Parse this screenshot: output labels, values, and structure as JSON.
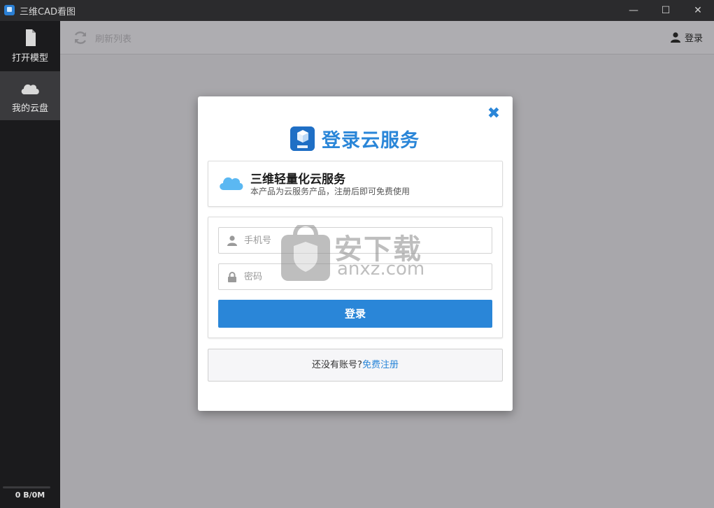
{
  "window": {
    "title": "三维CAD看图",
    "minimize_glyph": "—",
    "maximize_glyph": "☐",
    "close_glyph": "✕"
  },
  "sidebar": {
    "items": [
      {
        "label": "打开模型",
        "icon": "file-icon",
        "active": false
      },
      {
        "label": "我的云盘",
        "icon": "cloud-icon",
        "active": true
      }
    ],
    "storage": "0 B/0M"
  },
  "toolbar": {
    "refresh_label": "刷新列表",
    "login_label": "登录"
  },
  "dialog": {
    "close_glyph": "✖",
    "title": "登录云服务",
    "service": {
      "name": "三维轻量化云服务",
      "description": "本产品为云服务产品，注册后即可免费使用"
    },
    "phone_placeholder": "手机号",
    "password_placeholder": "密码",
    "login_button": "登录",
    "register_prompt": "还没有账号?",
    "register_link": "免费注册"
  },
  "watermark": {
    "cn": "安下载",
    "en": "anxz.com"
  },
  "colors": {
    "accent": "#2a86d8",
    "titlebar": "#2b2b2d",
    "overlay": "#a8a7ab"
  }
}
